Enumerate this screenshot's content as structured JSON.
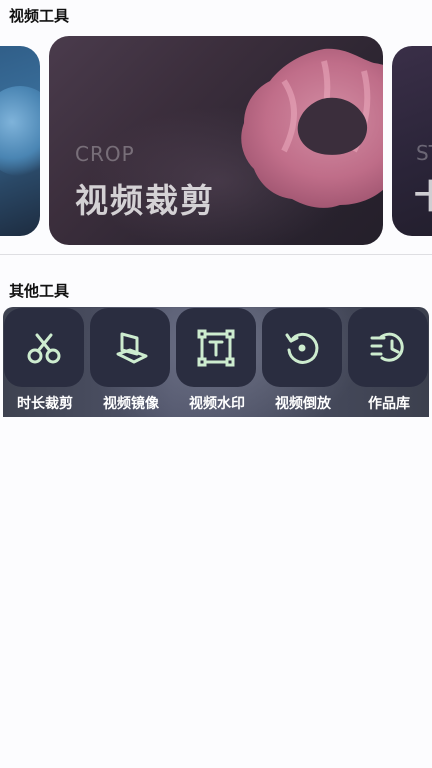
{
  "sections": {
    "video_tools_title": "视频工具",
    "other_tools_title": "其他工具"
  },
  "carousel": {
    "main_card": {
      "subtitle": "CROP",
      "title": "视频裁剪"
    },
    "right_card": {
      "subtitle": "ST",
      "title": "十"
    }
  },
  "tools": [
    {
      "label": "时长裁剪",
      "icon": "scissors-icon"
    },
    {
      "label": "视频镜像",
      "icon": "mirror-icon"
    },
    {
      "label": "视频水印",
      "icon": "text-box-icon"
    },
    {
      "label": "视频倒放",
      "icon": "rewind-circle-icon"
    },
    {
      "label": "作品库",
      "icon": "history-list-icon"
    }
  ],
  "colors": {
    "icon_stroke": "#cdeccf",
    "tile_bg": "#2a2d40",
    "label_text": "#ffffff"
  }
}
